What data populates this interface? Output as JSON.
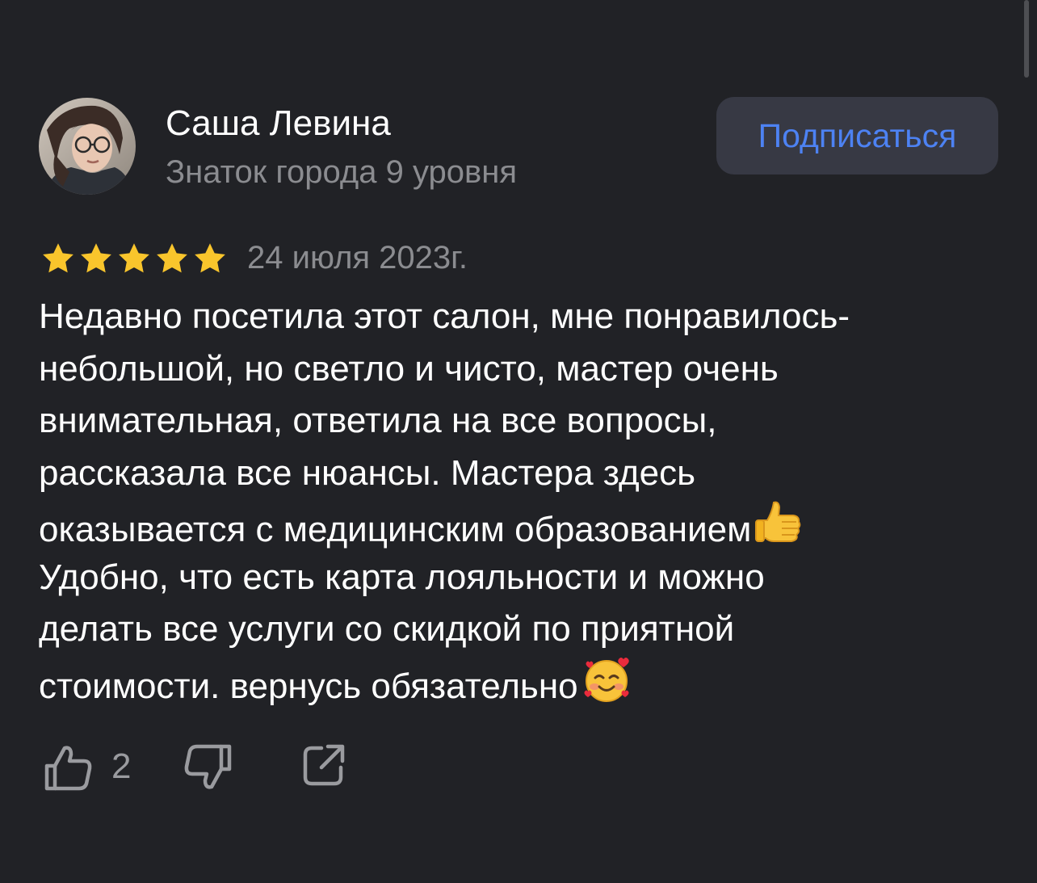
{
  "author": {
    "name": "Саша Левина",
    "level": "Знаток города 9 уровня",
    "avatar_icon": "user-photo"
  },
  "subscribe_label": "Подписаться",
  "review": {
    "rating": 5,
    "rating_max": 5,
    "date": "24 июля 2023г.",
    "lines": [
      "Недавно посетила этот салон, мне понравилось-",
      "небольшой, но светло и чисто, мастер очень",
      "внимательная, ответила на все вопросы,",
      "рассказала все нюансы. Мастера здесь",
      "оказывается с медицинским образованием",
      "Удобно, что есть карта лояльности и можно",
      "делать все услуги со скидкой по приятной",
      "стоимости. вернусь обязательно"
    ],
    "emojis": [
      "thumbs-up-emoji",
      "smiling-face-with-hearts-emoji"
    ]
  },
  "actions": {
    "like_count": "2",
    "like_icon": "thumbs-up-outline-icon",
    "dislike_icon": "thumbs-down-outline-icon",
    "share_icon": "share-icon"
  },
  "colors": {
    "background": "#212226",
    "accent": "#4d82f3",
    "button_bg": "#373944",
    "star": "#f9c52c",
    "secondary_text": "#8b8c90"
  }
}
